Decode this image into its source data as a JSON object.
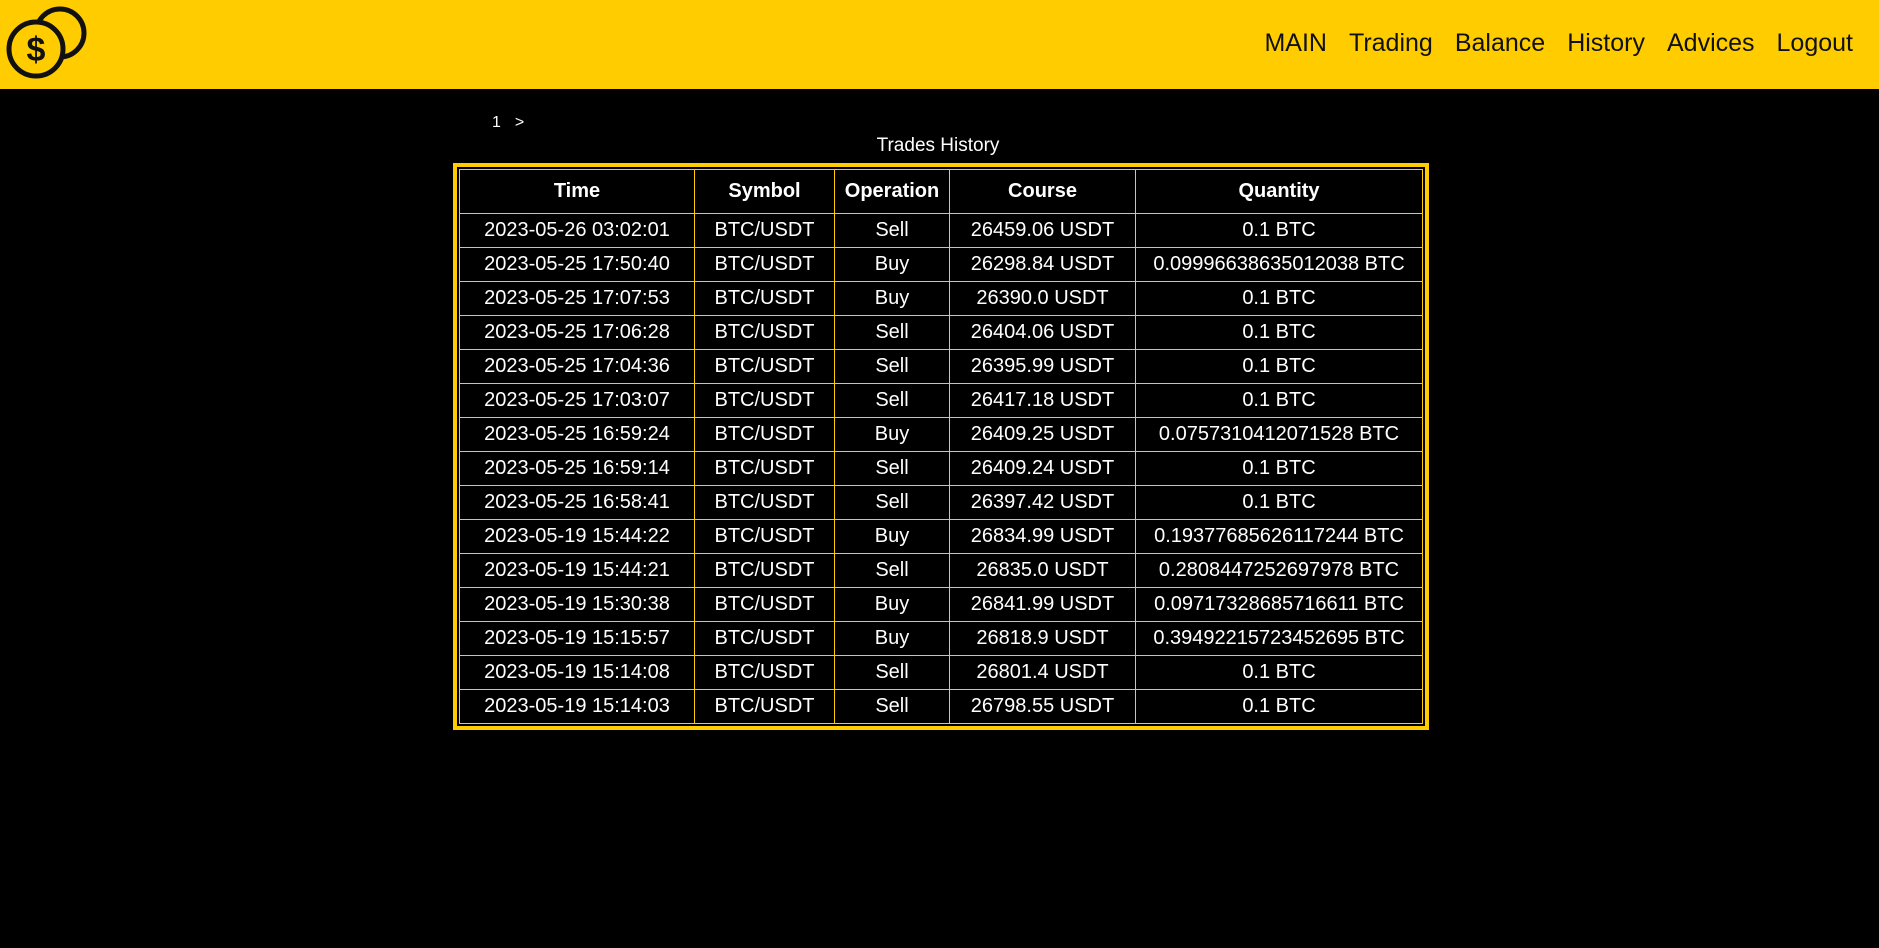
{
  "brand": {
    "logo_icon": "dollar-coins-icon",
    "accent_color": "#ffcc00",
    "background_color": "#000000"
  },
  "nav": {
    "items": [
      {
        "label": "MAIN"
      },
      {
        "label": "Trading"
      },
      {
        "label": "Balance"
      },
      {
        "label": "History"
      },
      {
        "label": "Advices"
      },
      {
        "label": "Logout"
      }
    ]
  },
  "pagination": {
    "current_page": "1",
    "next_label": ">"
  },
  "trades": {
    "caption": "Trades History",
    "columns": [
      "Time",
      "Symbol",
      "Operation",
      "Course",
      "Quantity"
    ],
    "rows": [
      {
        "time": "2023-05-26 03:02:01",
        "symbol": "BTC/USDT",
        "operation": "Sell",
        "course": "26459.06 USDT",
        "quantity": "0.1 BTC"
      },
      {
        "time": "2023-05-25 17:50:40",
        "symbol": "BTC/USDT",
        "operation": "Buy",
        "course": "26298.84 USDT",
        "quantity": "0.09996638635012038 BTC"
      },
      {
        "time": "2023-05-25 17:07:53",
        "symbol": "BTC/USDT",
        "operation": "Buy",
        "course": "26390.0 USDT",
        "quantity": "0.1 BTC"
      },
      {
        "time": "2023-05-25 17:06:28",
        "symbol": "BTC/USDT",
        "operation": "Sell",
        "course": "26404.06 USDT",
        "quantity": "0.1 BTC"
      },
      {
        "time": "2023-05-25 17:04:36",
        "symbol": "BTC/USDT",
        "operation": "Sell",
        "course": "26395.99 USDT",
        "quantity": "0.1 BTC"
      },
      {
        "time": "2023-05-25 17:03:07",
        "symbol": "BTC/USDT",
        "operation": "Sell",
        "course": "26417.18 USDT",
        "quantity": "0.1 BTC"
      },
      {
        "time": "2023-05-25 16:59:24",
        "symbol": "BTC/USDT",
        "operation": "Buy",
        "course": "26409.25 USDT",
        "quantity": "0.0757310412071528 BTC"
      },
      {
        "time": "2023-05-25 16:59:14",
        "symbol": "BTC/USDT",
        "operation": "Sell",
        "course": "26409.24 USDT",
        "quantity": "0.1 BTC"
      },
      {
        "time": "2023-05-25 16:58:41",
        "symbol": "BTC/USDT",
        "operation": "Sell",
        "course": "26397.42 USDT",
        "quantity": "0.1 BTC"
      },
      {
        "time": "2023-05-19 15:44:22",
        "symbol": "BTC/USDT",
        "operation": "Buy",
        "course": "26834.99 USDT",
        "quantity": "0.19377685626117244 BTC"
      },
      {
        "time": "2023-05-19 15:44:21",
        "symbol": "BTC/USDT",
        "operation": "Sell",
        "course": "26835.0 USDT",
        "quantity": "0.2808447252697978 BTC"
      },
      {
        "time": "2023-05-19 15:30:38",
        "symbol": "BTC/USDT",
        "operation": "Buy",
        "course": "26841.99 USDT",
        "quantity": "0.09717328685716611 BTC"
      },
      {
        "time": "2023-05-19 15:15:57",
        "symbol": "BTC/USDT",
        "operation": "Buy",
        "course": "26818.9 USDT",
        "quantity": "0.39492215723452695 BTC"
      },
      {
        "time": "2023-05-19 15:14:08",
        "symbol": "BTC/USDT",
        "operation": "Sell",
        "course": "26801.4 USDT",
        "quantity": "0.1 BTC"
      },
      {
        "time": "2023-05-19 15:14:03",
        "symbol": "BTC/USDT",
        "operation": "Sell",
        "course": "26798.55 USDT",
        "quantity": "0.1 BTC"
      }
    ]
  }
}
